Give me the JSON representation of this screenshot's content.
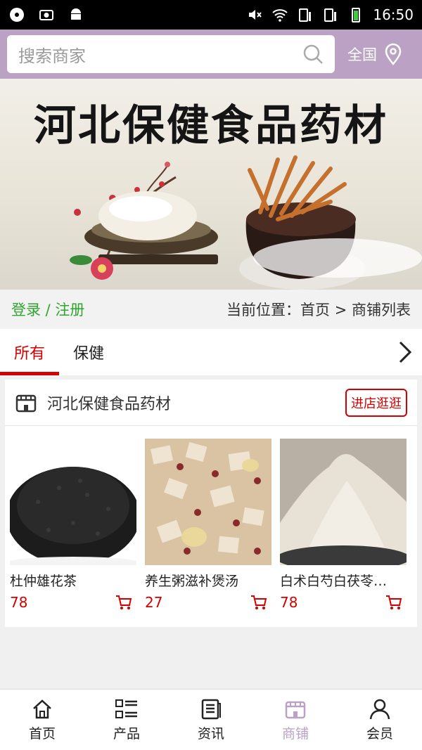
{
  "statusbar": {
    "time": "16:50"
  },
  "search": {
    "placeholder": "搜索商家",
    "region": "全国"
  },
  "banner": {
    "title": "河北保健食品药材"
  },
  "nav": {
    "login_register": "登录 / 注册",
    "breadcrumb": "当前位置：首页 > 商铺列表"
  },
  "tabs": [
    {
      "label": "所有",
      "active": true
    },
    {
      "label": "保健",
      "active": false
    }
  ],
  "shop": {
    "name": "河北保健食品药材",
    "visit_label": "进店逛逛",
    "products": [
      {
        "name": "杜仲雄花茶",
        "price": "78"
      },
      {
        "name": "养生粥滋补煲汤",
        "price": "27"
      },
      {
        "name": "白术白芍白茯苓…",
        "price": "78"
      }
    ]
  },
  "bottom_nav": [
    {
      "label": "首页",
      "icon": "home-icon"
    },
    {
      "label": "产品",
      "icon": "grid-list-icon"
    },
    {
      "label": "资讯",
      "icon": "news-icon"
    },
    {
      "label": "商铺",
      "icon": "shop-icon",
      "active": true
    },
    {
      "label": "会员",
      "icon": "user-icon"
    }
  ],
  "colors": {
    "accent": "#d40000",
    "brand": "#bba2c4",
    "login": "#2fa52f"
  }
}
